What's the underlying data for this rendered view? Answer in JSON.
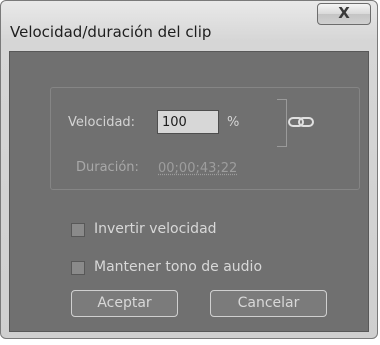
{
  "window": {
    "title": "Velocidad/duración del clip",
    "close_label": "X"
  },
  "speed": {
    "label": "Velocidad:",
    "value": "100",
    "unit": "%",
    "link_icon": "chain-link-icon"
  },
  "duration": {
    "label": "Duración:",
    "value": "00;00;43;22"
  },
  "options": [
    {
      "label": "Invertir velocidad",
      "checked": false
    },
    {
      "label": "Mantener tono de audio",
      "checked": false
    }
  ],
  "buttons": {
    "ok_label": "Aceptar",
    "cancel_label": "Cancelar"
  },
  "colors": {
    "panel_background": "#707070",
    "button_background": "#7b7b7b"
  }
}
